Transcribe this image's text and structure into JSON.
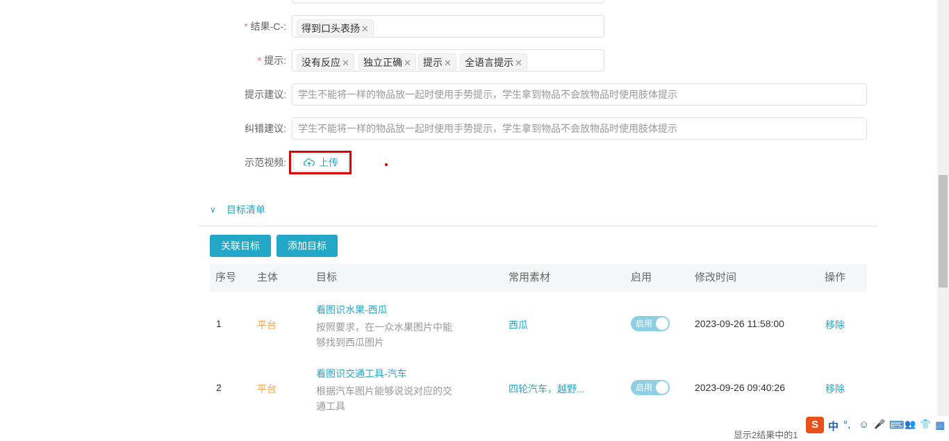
{
  "form": {
    "result_c": {
      "label": "结果-C-:",
      "required": true,
      "tags": [
        "得到口头表扬"
      ]
    },
    "hint": {
      "label": "提示:",
      "required": true,
      "tags": [
        "没有反应",
        "独立正确",
        "提示",
        "全语言提示"
      ]
    },
    "hint_suggestion": {
      "label": "提示建议:",
      "value": "学生不能将一样的物品放一起时使用手势提示，学生拿到物品不会放物品时使用肢体提示"
    },
    "correction_suggestion": {
      "label": "纠错建议:",
      "value": "学生不能将一样的物品放一起时使用手势提示，学生拿到物品不会放物品时使用肢体提示"
    },
    "demo_video": {
      "label": "示范视频:",
      "upload_label": "上传",
      "icon": "cloud-upload-icon"
    }
  },
  "targets": {
    "section_title": "目标清单",
    "link_button": "关联目标",
    "add_button": "添加目标",
    "columns": [
      "序号",
      "主体",
      "目标",
      "常用素材",
      "启用",
      "修改时间",
      "操作"
    ],
    "rows": [
      {
        "index": "1",
        "owner": "平台",
        "title": "看图识水果-西瓜",
        "desc_line1": "按照要求，在一众水果图片中能",
        "desc_line2": "够找到西瓜图片",
        "material": "西瓜",
        "enabled_label": "启用",
        "enabled": true,
        "modified": "2023-09-26 11:58:00",
        "action": "移除"
      },
      {
        "index": "2",
        "owner": "平台",
        "title": "看图识交通工具-汽车",
        "desc_line1": "根据汽车图片能够说说对应的交",
        "desc_line2": "通工具",
        "material": "四轮汽车，越野...",
        "enabled_label": "启用",
        "enabled": true,
        "modified": "2023-09-26 09:40:26",
        "action": "移除"
      }
    ],
    "footer": "显示2结果中的1"
  },
  "ime": {
    "items": [
      "中",
      "°,",
      "☺",
      "🎤",
      "⌨",
      "👥",
      "👕",
      "▦"
    ]
  },
  "colors": {
    "accent": "#22a7c7",
    "owner": "#f0a14b",
    "required": "#f56c6c",
    "highlight": "#e00000"
  }
}
